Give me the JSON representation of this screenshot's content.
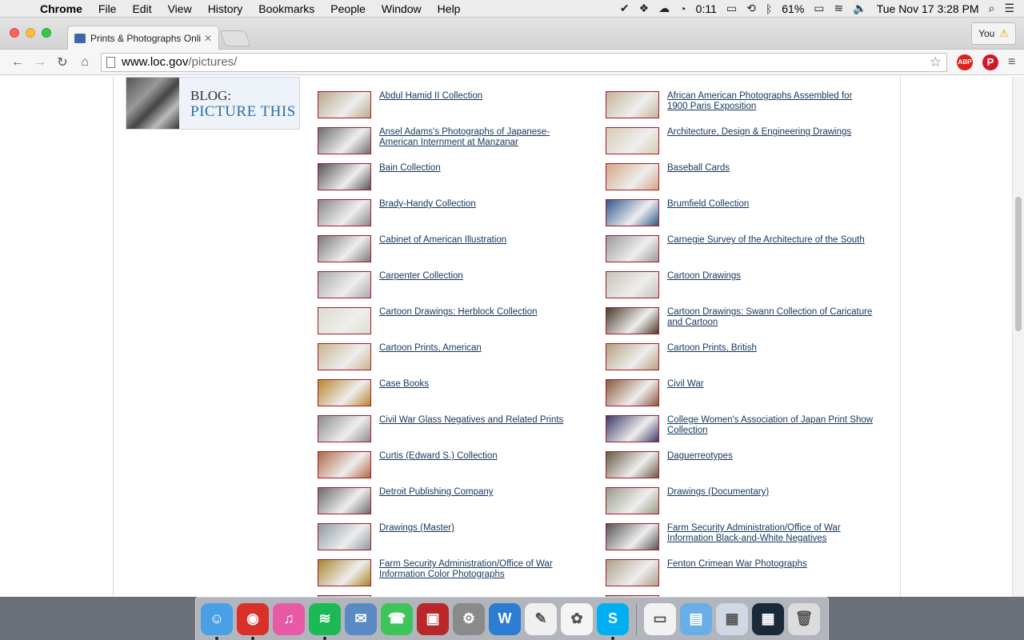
{
  "menubar": {
    "app": "Chrome",
    "items": [
      "File",
      "Edit",
      "View",
      "History",
      "Bookmarks",
      "People",
      "Window",
      "Help"
    ],
    "timer": "0:11",
    "battery": "61%",
    "datetime": "Tue Nov 17  3:28 PM"
  },
  "browser": {
    "tab_title": "Prints & Photographs Onli",
    "profile": "You",
    "url_host": "www.loc.gov",
    "url_path": "/pictures/",
    "ext_abp": "ABP"
  },
  "blog": {
    "line1": "BLOG:",
    "line2": "PICTURE THIS"
  },
  "collections": [
    {
      "label": "Abdul Hamid II Collection",
      "color": "#b8a88a"
    },
    {
      "label": "African American Photographs Assembled for 1900 Paris Exposition",
      "color": "#c4b49a"
    },
    {
      "label": "Ansel Adams's Photographs of Japanese-American Internment at Manzanar",
      "color": "#6e6e6e"
    },
    {
      "label": "Architecture, Design & Engineering Drawings",
      "color": "#d8ccb0"
    },
    {
      "label": "Bain Collection",
      "color": "#555555"
    },
    {
      "label": "Baseball Cards",
      "color": "#d4a683"
    },
    {
      "label": "Brady-Handy Collection",
      "color": "#888888"
    },
    {
      "label": "Brumfield Collection",
      "color": "#2d5a8c"
    },
    {
      "label": "Cabinet of American Illustration",
      "color": "#7a7a7a"
    },
    {
      "label": "Carnegie Survey of the Architecture of the South",
      "color": "#9a9a9a"
    },
    {
      "label": "Carpenter Collection",
      "color": "#aaaaaa"
    },
    {
      "label": "Cartoon Drawings",
      "color": "#c8c3b8"
    },
    {
      "label": "Cartoon Drawings: Herblock Collection",
      "color": "#dcdcd0"
    },
    {
      "label": "Cartoon Drawings: Swann Collection of Caricature and Cartoon",
      "color": "#4a3a2a"
    },
    {
      "label": "Cartoon Prints, American",
      "color": "#c9b48e"
    },
    {
      "label": "Cartoon Prints, British",
      "color": "#b7a07e"
    },
    {
      "label": "Case Books",
      "color": "#b8862c"
    },
    {
      "label": "Civil War",
      "color": "#8a5a3a"
    },
    {
      "label": "Civil War Glass Negatives and Related Prints",
      "color": "#8c8c8c"
    },
    {
      "label": "College Women's Association of Japan Print Show Collection",
      "color": "#3a3a6a"
    },
    {
      "label": "Curtis (Edward S.) Collection",
      "color": "#b06a45"
    },
    {
      "label": "Daguerreotypes",
      "color": "#6a5a45"
    },
    {
      "label": "Detroit Publishing Company",
      "color": "#6a6a6a"
    },
    {
      "label": "Drawings (Documentary)",
      "color": "#9a9a88"
    },
    {
      "label": "Drawings (Master)",
      "color": "#8c9aa0"
    },
    {
      "label": "Farm Security Administration/Office of War Information Black-and-White Negatives",
      "color": "#555555"
    },
    {
      "label": "Farm Security Administration/Office of War Information Color Photographs",
      "color": "#a8862c"
    },
    {
      "label": "Fenton Crimean War Photographs",
      "color": "#b0a088"
    },
    {
      "label": "",
      "color": "#b8a88a"
    },
    {
      "label": "",
      "color": "#b8a88a"
    }
  ],
  "dock": [
    {
      "name": "finder",
      "color": "#4aa0e6",
      "glyph": "☺",
      "running": true
    },
    {
      "name": "chrome",
      "color": "#d9302a",
      "glyph": "◉",
      "running": true
    },
    {
      "name": "itunes",
      "color": "#e85aa6",
      "glyph": "♫",
      "running": false
    },
    {
      "name": "spotify",
      "color": "#1db954",
      "glyph": "≋",
      "running": true
    },
    {
      "name": "preview",
      "color": "#5a8ac6",
      "glyph": "✉",
      "running": false
    },
    {
      "name": "facetime",
      "color": "#3ec55a",
      "glyph": "☎",
      "running": false
    },
    {
      "name": "photo-booth",
      "color": "#b8282a",
      "glyph": "▣",
      "running": false
    },
    {
      "name": "system-preferences",
      "color": "#8a8a8a",
      "glyph": "⚙",
      "running": false
    },
    {
      "name": "word",
      "color": "#2b7cd3",
      "glyph": "W",
      "running": false
    },
    {
      "name": "textedit",
      "color": "#f0f0f0",
      "glyph": "✎",
      "running": false
    },
    {
      "name": "photos",
      "color": "#f5f5f5",
      "glyph": "✿",
      "running": false
    },
    {
      "name": "skype",
      "color": "#00aff0",
      "glyph": "S",
      "running": true
    },
    {
      "name": "document",
      "color": "#f2f2f2",
      "glyph": "▭",
      "running": false
    },
    {
      "name": "folder",
      "color": "#6aaee8",
      "glyph": "▤",
      "running": false
    },
    {
      "name": "screenshot-1",
      "color": "#cfd8e4",
      "glyph": "▦",
      "running": false
    },
    {
      "name": "screenshot-2",
      "color": "#1a2a3a",
      "glyph": "▦",
      "running": false
    },
    {
      "name": "trash",
      "color": "#dcdcdc",
      "glyph": "🗑",
      "running": false
    }
  ]
}
